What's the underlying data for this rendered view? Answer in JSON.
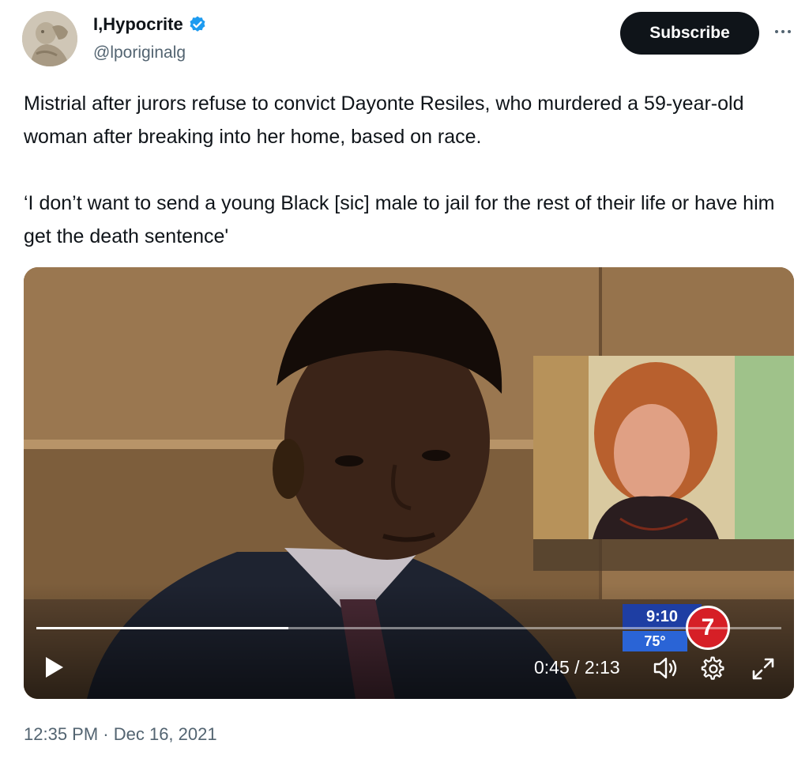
{
  "author": {
    "display_name": "I,Hypocrite",
    "handle": "@lporiginalg",
    "verified": true
  },
  "actions": {
    "subscribe_label": "Subscribe",
    "more_icon": "more-horizontal-icon"
  },
  "tweet": {
    "paragraphs": [
      "Mistrial after jurors refuse to convict Dayonte Resiles, who murdered a 59-year-old woman after breaking into her home, based on race.",
      "‘I don’t want to send a young Black [sic] male to jail for the rest of their life or have him get the death sentence'"
    ],
    "timestamp": "12:35 PM · Dec 16, 2021"
  },
  "video": {
    "current_time": "0:45",
    "duration": "2:13",
    "time_display": "0:45 / 2:13",
    "progress_fraction": 0.338,
    "station_bug": {
      "time": "9:10",
      "temperature": "75°",
      "channel": "7"
    },
    "controls": [
      "play-icon",
      "volume-icon",
      "settings-gear-icon",
      "fullscreen-expand-icon"
    ]
  },
  "colors": {
    "verified_blue": "#1d9bf0",
    "subscribe_bg": "#0f1419",
    "secondary_text": "#536471"
  }
}
